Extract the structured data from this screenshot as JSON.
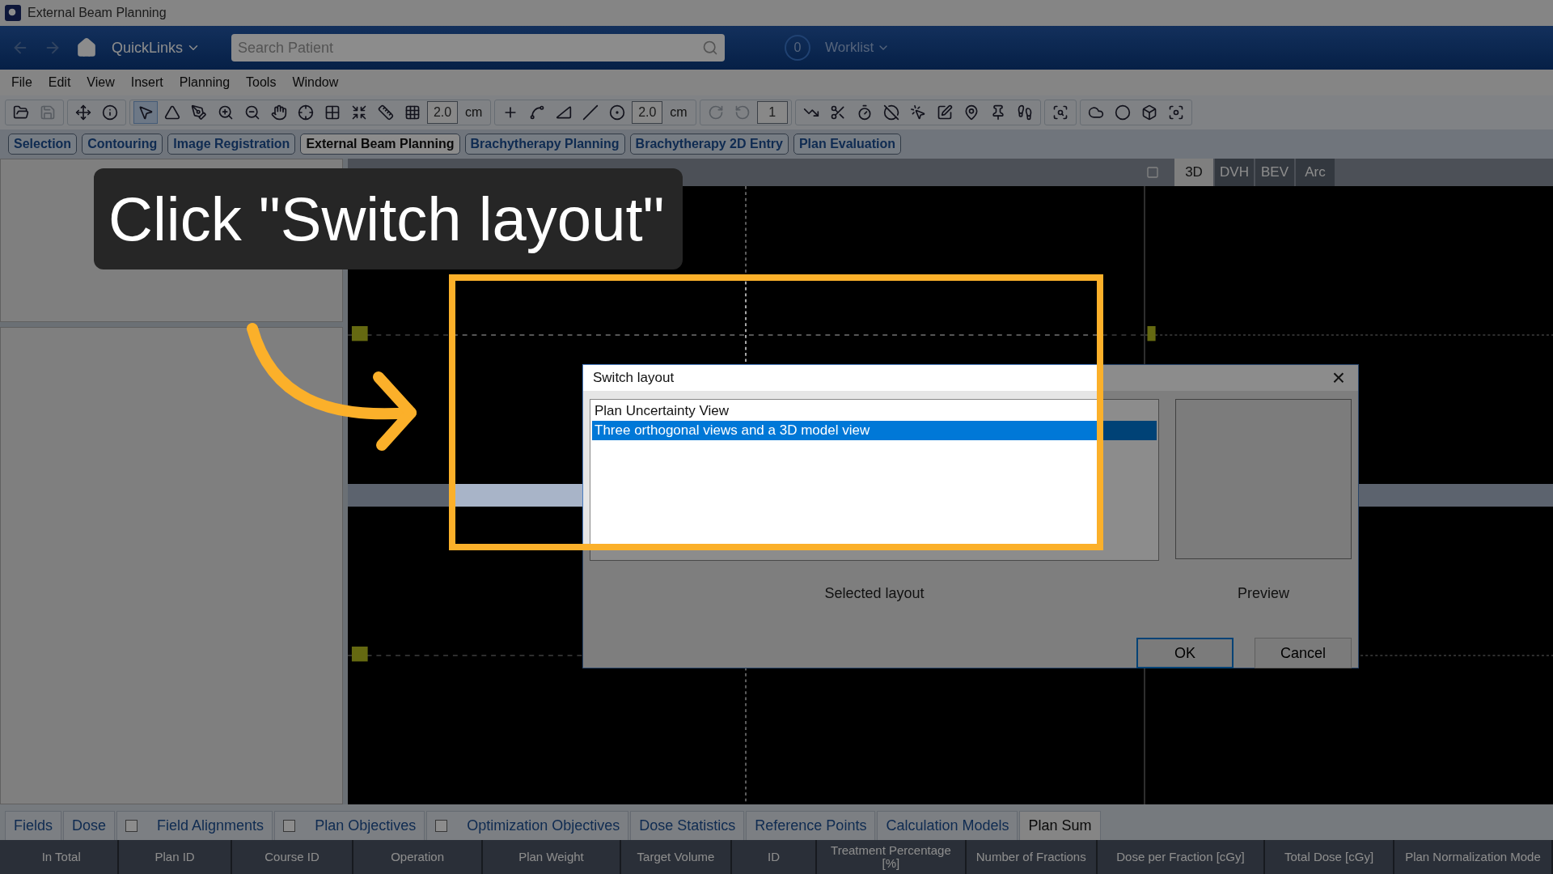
{
  "window": {
    "title": "External Beam Planning"
  },
  "nav": {
    "back": {
      "disabled": true
    },
    "forward": {
      "disabled": true
    },
    "quicklinks": "QuickLinks",
    "search": {
      "placeholder": "Search Patient"
    },
    "worklist": {
      "count": "0",
      "label": "Worklist"
    }
  },
  "menu": [
    "File",
    "Edit",
    "View",
    "Insert",
    "Planning",
    "Tools",
    "Window"
  ],
  "toolbar": [
    [
      {
        "kind": "icon",
        "selected": false,
        "disabled": false
      },
      {
        "kind": "icon",
        "selected": false,
        "disabled": true
      }
    ],
    [
      {
        "kind": "icon",
        "selected": false,
        "disabled": false
      },
      {
        "kind": "icon",
        "selected": false,
        "disabled": false
      }
    ],
    [
      {
        "kind": "icon",
        "selected": true,
        "disabled": false
      },
      {
        "kind": "icon",
        "selected": false,
        "disabled": false
      },
      {
        "kind": "icon",
        "selected": false,
        "disabled": false
      },
      {
        "kind": "icon",
        "selected": false,
        "disabled": false
      },
      {
        "kind": "icon",
        "selected": false,
        "disabled": false
      },
      {
        "kind": "icon",
        "selected": false,
        "disabled": false
      },
      {
        "kind": "icon",
        "selected": false,
        "disabled": false
      },
      {
        "kind": "icon",
        "selected": false,
        "disabled": false
      },
      {
        "kind": "icon",
        "selected": false,
        "disabled": false
      },
      {
        "kind": "icon",
        "selected": false,
        "disabled": false
      },
      {
        "kind": "icon",
        "selected": false,
        "disabled": false
      },
      {
        "kind": "field",
        "value": "2.0"
      },
      {
        "kind": "unit",
        "text": "cm"
      }
    ],
    [
      {
        "kind": "icon",
        "selected": false,
        "disabled": false
      },
      {
        "kind": "icon",
        "selected": false,
        "disabled": false
      },
      {
        "kind": "icon",
        "selected": false,
        "disabled": false
      },
      {
        "kind": "icon",
        "selected": false,
        "disabled": false
      },
      {
        "kind": "icon",
        "selected": false,
        "disabled": false
      },
      {
        "kind": "field",
        "value": "2.0"
      },
      {
        "kind": "unit",
        "text": "cm"
      }
    ],
    [
      {
        "kind": "icon",
        "selected": false,
        "disabled": true
      },
      {
        "kind": "icon",
        "selected": false,
        "disabled": true
      },
      {
        "kind": "field",
        "value": "1"
      }
    ],
    [
      {
        "kind": "icon",
        "selected": false,
        "disabled": false
      },
      {
        "kind": "icon",
        "selected": false,
        "disabled": false
      },
      {
        "kind": "icon",
        "selected": false,
        "disabled": false
      },
      {
        "kind": "icon",
        "selected": false,
        "disabled": false
      },
      {
        "kind": "icon",
        "selected": false,
        "disabled": false
      },
      {
        "kind": "icon",
        "selected": false,
        "disabled": false
      },
      {
        "kind": "icon",
        "selected": false,
        "disabled": false
      },
      {
        "kind": "icon",
        "selected": false,
        "disabled": false
      },
      {
        "kind": "icon",
        "selected": false,
        "disabled": false
      }
    ],
    [
      {
        "kind": "icon",
        "selected": false,
        "disabled": false
      }
    ],
    [
      {
        "kind": "icon",
        "selected": false,
        "disabled": false
      },
      {
        "kind": "icon",
        "selected": false,
        "disabled": false
      },
      {
        "kind": "icon",
        "selected": false,
        "disabled": false
      },
      {
        "kind": "icon",
        "selected": false,
        "disabled": false
      }
    ]
  ],
  "workspaces": [
    {
      "label": "Selection",
      "selected": false
    },
    {
      "label": "Contouring",
      "selected": false
    },
    {
      "label": "Image Registration",
      "selected": false
    },
    {
      "label": "External Beam Planning",
      "selected": true
    },
    {
      "label": "Brachytherapy Planning",
      "selected": false
    },
    {
      "label": "Brachytherapy 2D Entry",
      "selected": false
    },
    {
      "label": "Plan Evaluation",
      "selected": false
    }
  ],
  "viewer_tabs": [
    {
      "label": "3D",
      "selected": true
    },
    {
      "label": "DVH",
      "selected": false
    },
    {
      "label": "BEV",
      "selected": false
    },
    {
      "label": "Arc",
      "selected": false
    }
  ],
  "dialog": {
    "title": "Switch layout",
    "close": "×",
    "layouts": [
      {
        "label": "Plan Uncertainty View",
        "selected": false
      },
      {
        "label": "Three orthogonal views and a 3D model view",
        "selected": true
      }
    ],
    "list_caption": "Selected layout",
    "preview_caption": "Preview",
    "buttons": [
      "OK",
      "Cancel"
    ]
  },
  "bottom_tabs": [
    {
      "label": "Fields",
      "checkbox": false,
      "selected": false
    },
    {
      "label": "Dose",
      "checkbox": false,
      "selected": false
    },
    {
      "label": "Field Alignments",
      "checkbox": true,
      "selected": false
    },
    {
      "label": "Plan Objectives",
      "checkbox": true,
      "selected": false
    },
    {
      "label": "Optimization Objectives",
      "checkbox": true,
      "selected": false
    },
    {
      "label": "Dose Statistics",
      "checkbox": false,
      "selected": false
    },
    {
      "label": "Reference Points",
      "checkbox": false,
      "selected": false
    },
    {
      "label": "Calculation Models",
      "checkbox": false,
      "selected": false
    },
    {
      "label": "Plan Sum",
      "checkbox": false,
      "selected": true
    }
  ],
  "table": {
    "columns": [
      "In Total",
      "Plan ID",
      "Course ID",
      "Operation",
      "Plan Weight",
      "Target Volume",
      "ID",
      "Treatment Percentage [%]",
      "Number of Fractions",
      "Dose per Fraction [cGy]",
      "Total Dose [cGy]",
      "Plan Normalization Mode"
    ]
  },
  "callout": {
    "text": "Click \"Switch layout\""
  }
}
